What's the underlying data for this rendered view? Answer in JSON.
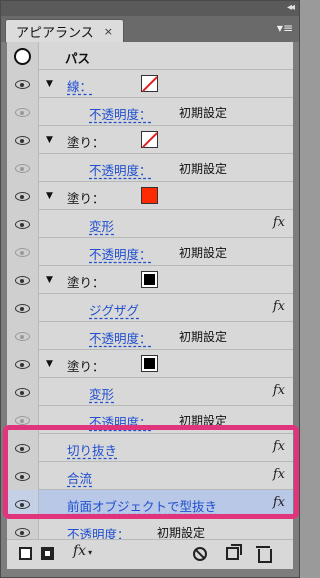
{
  "panel": {
    "title": "アピアランス",
    "tab_close": "×",
    "collapse": "◂◂",
    "menu": "▾≡"
  },
  "header": {
    "object_label": "パス"
  },
  "rows": [
    {
      "label": "線：",
      "swatch": "none"
    },
    {
      "label": "不透明度：",
      "value": "初期設定"
    },
    {
      "label": "塗り：",
      "swatch": "none"
    },
    {
      "label": "不透明度：",
      "value": "初期設定"
    },
    {
      "label": "塗り：",
      "swatch": "red"
    },
    {
      "label": "変形",
      "fx": "fx"
    },
    {
      "label": "不透明度：",
      "value": "初期設定"
    },
    {
      "label": "塗り：",
      "swatch": "black"
    },
    {
      "label": "ジグザグ",
      "fx": "fx"
    },
    {
      "label": "不透明度：",
      "value": "初期設定"
    },
    {
      "label": "塗り：",
      "swatch": "black"
    },
    {
      "label": "変形",
      "fx": "fx"
    },
    {
      "label": "不透明度：",
      "value": "初期設定"
    },
    {
      "label": "切り抜き",
      "fx": "fx"
    },
    {
      "label": "合流",
      "fx": "fx"
    },
    {
      "label": "前面オブジェクトで型抜き",
      "fx": "fx",
      "selected": true
    },
    {
      "label": "不透明度：",
      "value": "初期設定"
    }
  ],
  "toolbar": {
    "fx_label": "fx"
  },
  "colors": {
    "highlight": "#e0347c",
    "link": "#1f4fd0",
    "swatch_red": "#ff2a00"
  }
}
